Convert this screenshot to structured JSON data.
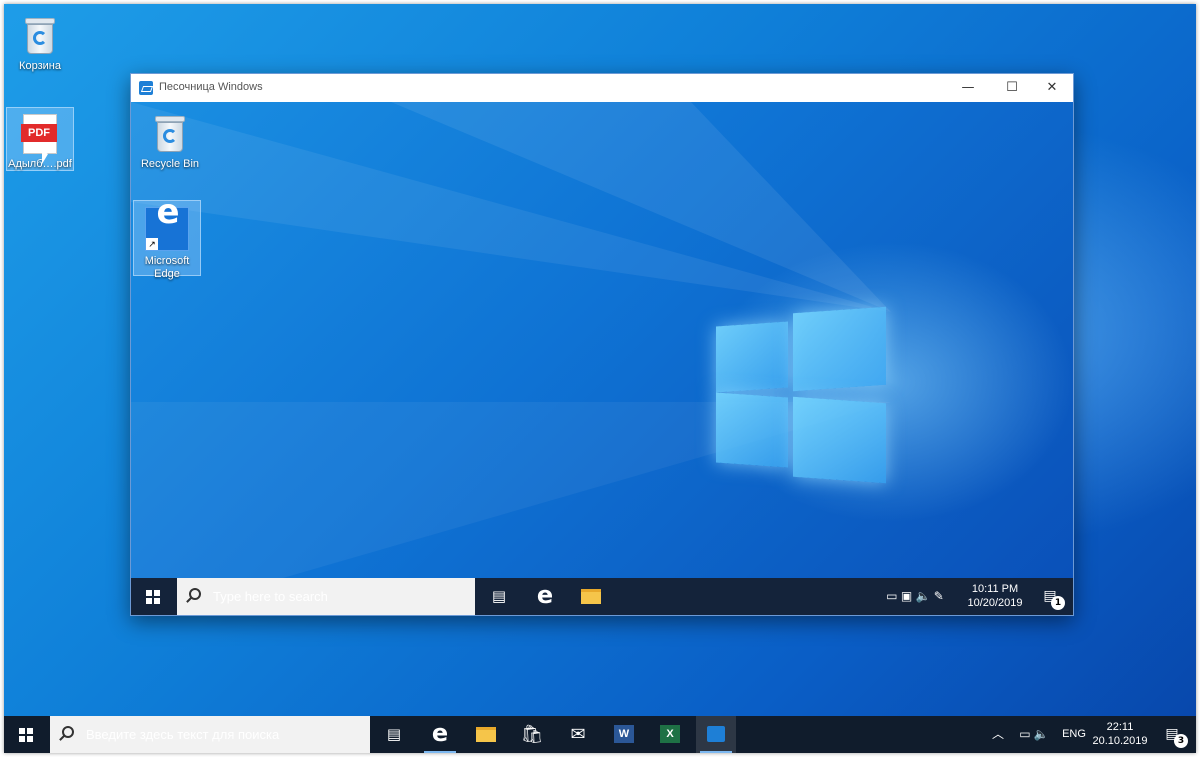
{
  "desktop": {
    "icons": [
      {
        "label": "Корзина"
      },
      {
        "label": "Адылб….pdf",
        "badge": "PDF"
      }
    ]
  },
  "sandbox_window": {
    "title": "Песочница Windows",
    "controls": {
      "minimize": "—",
      "maximize": "☐",
      "close": "✕"
    },
    "inner_desktop": {
      "icons": [
        {
          "label": "Recycle Bin"
        },
        {
          "label": "Microsoft Edge"
        }
      ]
    },
    "inner_taskbar": {
      "search_placeholder": "Type here to search",
      "apps": [
        "task-view",
        "edge",
        "file-explorer"
      ],
      "time": "10:11 PM",
      "date": "10/20/2019",
      "notification_count": "1"
    }
  },
  "taskbar": {
    "search_placeholder": "Введите здесь текст для поиска",
    "apps": [
      "task-view",
      "edge",
      "file-explorer",
      "store",
      "mail",
      "word",
      "excel",
      "sandbox"
    ],
    "language": "ENG",
    "time": "22:11",
    "date": "20.10.2019",
    "notification_count": "3"
  },
  "colors": {
    "wallpaper": "#0f7fd8",
    "taskbar": "#101c2c",
    "accent": "#1e8be8"
  }
}
